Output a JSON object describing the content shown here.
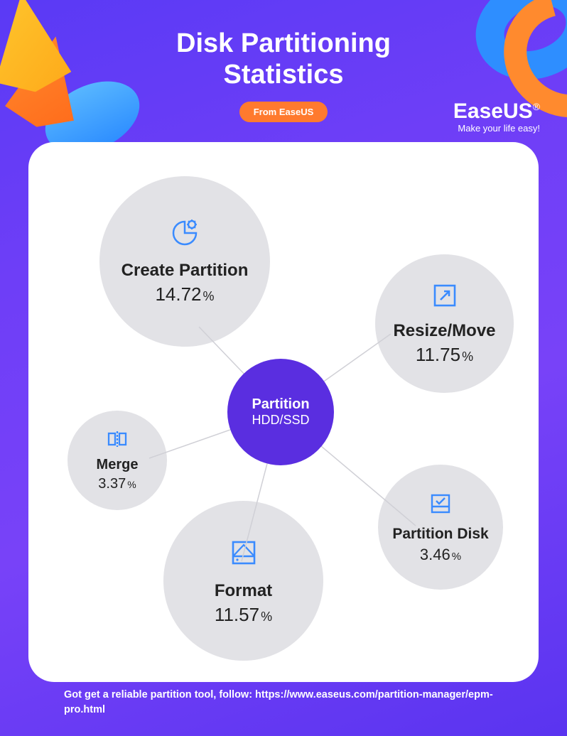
{
  "header": {
    "title_line1": "Disk Partitioning",
    "title_line2": "Statistics",
    "badge": "From EaseUS"
  },
  "brand": {
    "name": "EaseUS",
    "registered": "®",
    "tagline": "Make your life easy!"
  },
  "center": {
    "line1": "Partition",
    "line2": "HDD/SSD"
  },
  "nodes": {
    "create": {
      "label": "Create Partition",
      "value": "14.72",
      "pct": "%"
    },
    "resize": {
      "label": "Resize/Move",
      "value": "11.75",
      "pct": "%"
    },
    "merge": {
      "label": "Merge",
      "value": "3.37",
      "pct": "%"
    },
    "format": {
      "label": "Format",
      "value": "11.57",
      "pct": "%"
    },
    "pdisk": {
      "label": "Partition Disk",
      "value": "3.46",
      "pct": "%"
    }
  },
  "footer": {
    "text": "Got get a reliable partition tool, follow: https://www.easeus.com/partition-manager/epm-pro.html"
  },
  "chart_data": {
    "type": "bubble-radial",
    "center_label": "Partition HDD/SSD",
    "categories": [
      "Create Partition",
      "Resize/Move",
      "Merge",
      "Format",
      "Partition Disk"
    ],
    "values": [
      14.72,
      11.75,
      3.37,
      11.57,
      3.46
    ],
    "unit": "%",
    "title": "Disk Partitioning Statistics",
    "source": "EaseUS"
  }
}
